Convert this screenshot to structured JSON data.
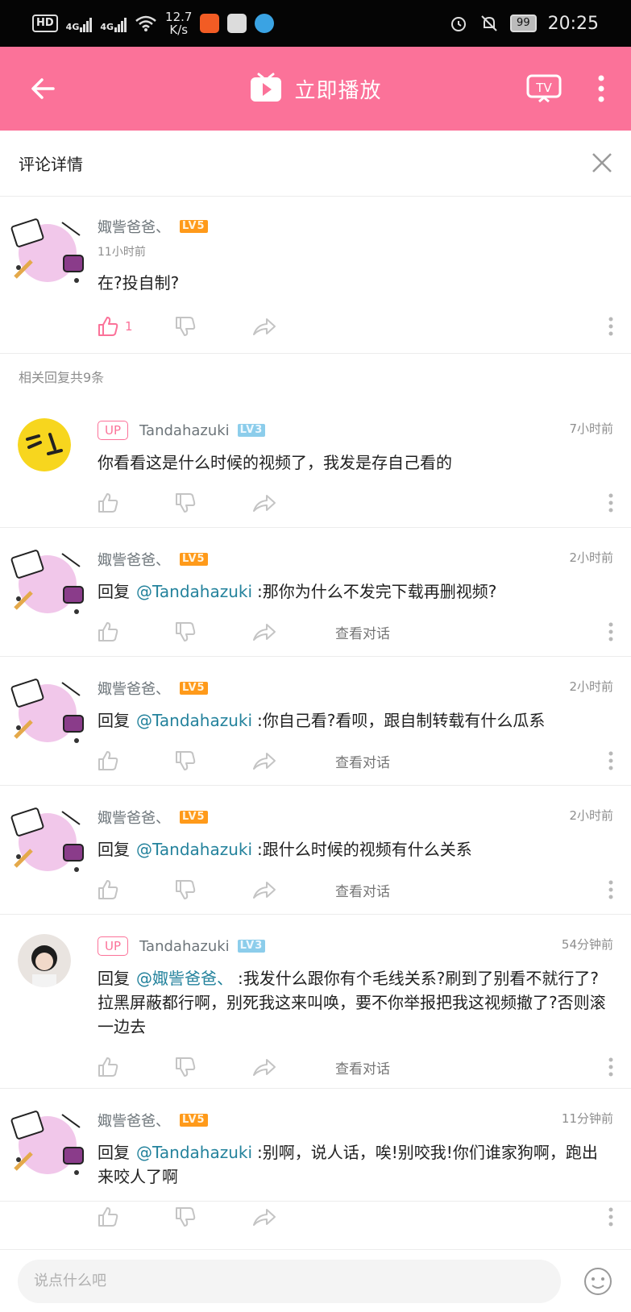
{
  "status_bar": {
    "hd": "HD",
    "net1": "4G",
    "net2": "4G",
    "speed_value": "12.7",
    "speed_unit": "K/s",
    "battery": "99",
    "time": "20:25"
  },
  "header": {
    "play_label": "立即播放",
    "tv_label": "TV"
  },
  "detail": {
    "title": "评论详情"
  },
  "main_comment": {
    "user": "娵訾爸爸、",
    "level": "LV5",
    "time": "11小时前",
    "text": "在?投自制?",
    "like_count": "1"
  },
  "replies_count_label": "相关回复共9条",
  "replies": [
    {
      "up_badge": "UP",
      "user": "Tandahazuki",
      "level": "LV3",
      "time": "7小时前",
      "reply_prefix": "",
      "mention": "",
      "text": "你看看这是什么时候的视频了，我发是存自己看的",
      "view_conversation": ""
    },
    {
      "up_badge": "",
      "user": "娵訾爸爸、",
      "level": "LV5",
      "time": "2小时前",
      "reply_prefix": "回复",
      "mention": "@Tandahazuki",
      "text": ":那你为什么不发完下载再删视频?",
      "view_conversation": "查看对话"
    },
    {
      "up_badge": "",
      "user": "娵訾爸爸、",
      "level": "LV5",
      "time": "2小时前",
      "reply_prefix": "回复",
      "mention": "@Tandahazuki",
      "text": ":你自己看?看呗，跟自制转载有什么瓜系",
      "view_conversation": "查看对话"
    },
    {
      "up_badge": "",
      "user": "娵訾爸爸、",
      "level": "LV5",
      "time": "2小时前",
      "reply_prefix": "回复",
      "mention": "@Tandahazuki",
      "text": ":跟什么时候的视频有什么关系",
      "view_conversation": "查看对话"
    },
    {
      "up_badge": "UP",
      "user": "Tandahazuki",
      "level": "LV3",
      "time": "54分钟前",
      "reply_prefix": "回复",
      "mention": "@娵訾爸爸、",
      "text": ":我发什么跟你有个毛线关系?刷到了别看不就行了?拉黑屏蔽都行啊，别死我这来叫唤，要不你举报把我这视频撤了?否则滚一边去",
      "view_conversation": "查看对话"
    },
    {
      "up_badge": "",
      "user": "娵訾爸爸、",
      "level": "LV5",
      "time": "11分钟前",
      "reply_prefix": "回复",
      "mention": "@Tandahazuki",
      "text": ":别啊，说人话，唉!别咬我!你们谁家狗啊，跑出来咬人了啊",
      "view_conversation": ""
    }
  ],
  "input": {
    "placeholder": "说点什么吧"
  },
  "colors": {
    "brand_pink": "#fb7299",
    "mention_blue": "#23829c",
    "level5_orange": "#ff9a1a",
    "level3_blue": "#8ccdeb"
  }
}
